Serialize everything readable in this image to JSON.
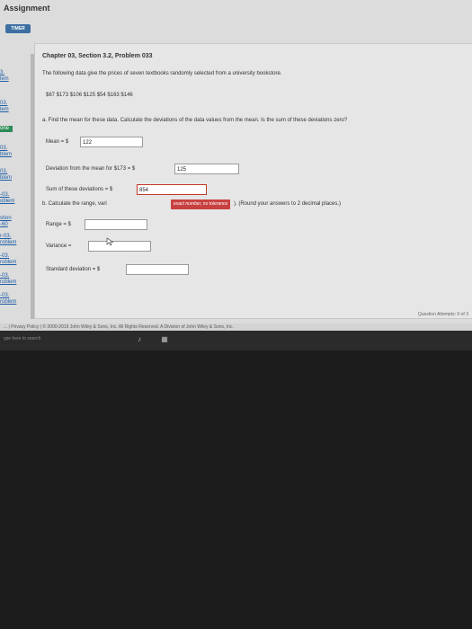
{
  "app": {
    "title": "Assignment",
    "timer_label": "TIMER"
  },
  "sidebar": {
    "items": [
      {
        "label": "3.\nlem"
      },
      {
        "label": "03.\nlem"
      },
      {
        "label": "one"
      },
      {
        "label": "03.\nblem"
      },
      {
        "label": "03.\nblem"
      },
      {
        "label": "-03.\noblem"
      },
      {
        "label": "stion\n-60"
      },
      {
        "label": "r-03.\nroblem"
      },
      {
        "label": "-03.\nroblem"
      },
      {
        "label": "-03.\nroblem"
      },
      {
        "label": "-03.\nroblem"
      }
    ]
  },
  "problem": {
    "title": "Chapter 03, Section 3.2, Problem 033",
    "intro": "The following data give the prices of seven textbooks randomly selected from a university bookstore.",
    "data_line": "$87  $173  $106  $125  $54  $163  $146",
    "part_a": "a. Find the mean for these data. Calculate the deviations of the data values from the mean. Is the sum of these deviations zero?",
    "mean_label": "Mean = $",
    "mean_value": "122",
    "deviation_label": "Deviation from the mean for $173 = $",
    "deviation_value": "125",
    "sum_label": "Sum of these deviations = $",
    "sum_value": "854",
    "part_b_prefix": "b. Calculate the range, vari",
    "part_b_suffix": "). (Round your answers to 2 decimal places.)",
    "tooltip": "exact number, no tolerance",
    "range_label": "Range = $",
    "range_value": "",
    "variance_label": "Variance =",
    "variance_value": "",
    "std_label": "Standard deviation = $",
    "std_value": ""
  },
  "attempts": "Question Attempts: 0 of 3",
  "footer": "...   |   Privacy Policy   |   © 2000-2019 John Wiley & Sons, Inc. All Rights Reserved. A Division of John Wiley & Sons, Inc.",
  "taskbar": {
    "search_hint": "ype here to search"
  }
}
